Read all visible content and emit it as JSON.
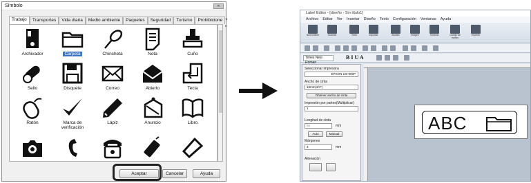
{
  "dialog": {
    "title": "Símbolo",
    "close_glyph": "✕",
    "tabs": [
      "Trabajo",
      "Transportes",
      "Vida diaria",
      "Medio ambiente",
      "Paquetes",
      "Seguridad",
      "Turismo",
      "Prohibicione"
    ],
    "tab_arrows": "◂ ▸",
    "items": [
      {
        "label": "Archivador",
        "icon": "binder-icon"
      },
      {
        "label": "Carpeta",
        "icon": "folder-icon",
        "selected": true
      },
      {
        "label": "Chincheta",
        "icon": "pushpin-icon"
      },
      {
        "label": "Nota",
        "icon": "note-icon"
      },
      {
        "label": "Cuño",
        "icon": "stamp-icon"
      },
      {
        "label": "Sello",
        "icon": "seal-icon"
      },
      {
        "label": "Disquete",
        "icon": "floppy-icon"
      },
      {
        "label": "Correo",
        "icon": "mail-icon"
      },
      {
        "label": "Abierto",
        "icon": "open-mail-icon"
      },
      {
        "label": "Tecla",
        "icon": "enter-key-icon"
      },
      {
        "label": "Ratón",
        "icon": "mouse-icon"
      },
      {
        "label": "Marca de verificación",
        "icon": "checkmark-icon"
      },
      {
        "label": "Lápiz",
        "icon": "pencil-icon"
      },
      {
        "label": "Anuncio",
        "icon": "announcement-icon"
      },
      {
        "label": "Libro",
        "icon": "book-icon"
      },
      {
        "label": "",
        "icon": "camera-icon"
      },
      {
        "label": "",
        "icon": "phone-handset-icon"
      },
      {
        "label": "",
        "icon": "telephone-icon"
      },
      {
        "label": "",
        "icon": "mobile-phone-icon"
      },
      {
        "label": "",
        "icon": "tag-icon"
      }
    ],
    "buttons": {
      "accept": "Aceptar",
      "cancel": "Cancelar",
      "help": "Ayuda"
    }
  },
  "arrow": {
    "color": "#111111"
  },
  "app": {
    "title": "Label Editor - [diseño - Sin título1]",
    "menu": [
      "Archivo",
      "Editar",
      "Ver",
      "Insertar",
      "Diseño",
      "Texto",
      "Configuración",
      "Ventanas",
      "Ayuda"
    ],
    "ribbon": [
      "Nuevo/Abrir",
      "Guardar",
      "Texto",
      "Importar",
      "Bordes",
      "Imagen",
      "Símbolo",
      "Código de barras",
      "Imprimir"
    ],
    "font_name": "Times New Roman",
    "format_glyphs": "B I U A",
    "side": {
      "printer_label": "Seleccionar impresora",
      "printer_value": "EPSON LW-900P",
      "tape_width_label": "Ancho de cinta",
      "tape_width_value": "18mm(3/4\")",
      "get_width_button": "Obtener ancho de cinta",
      "print_parts_label": "Impresión por partes(Multiplicar)",
      "print_parts_value": "1",
      "tape_length_label": "Longitud de cinta",
      "tape_length_value": "56",
      "unit": "mm",
      "auto_button": "Auto",
      "manual_button": "Manual",
      "margins_label": "Márgenes",
      "margins_value": "3",
      "align_label": "Alineación"
    },
    "label_text": "ABC"
  }
}
